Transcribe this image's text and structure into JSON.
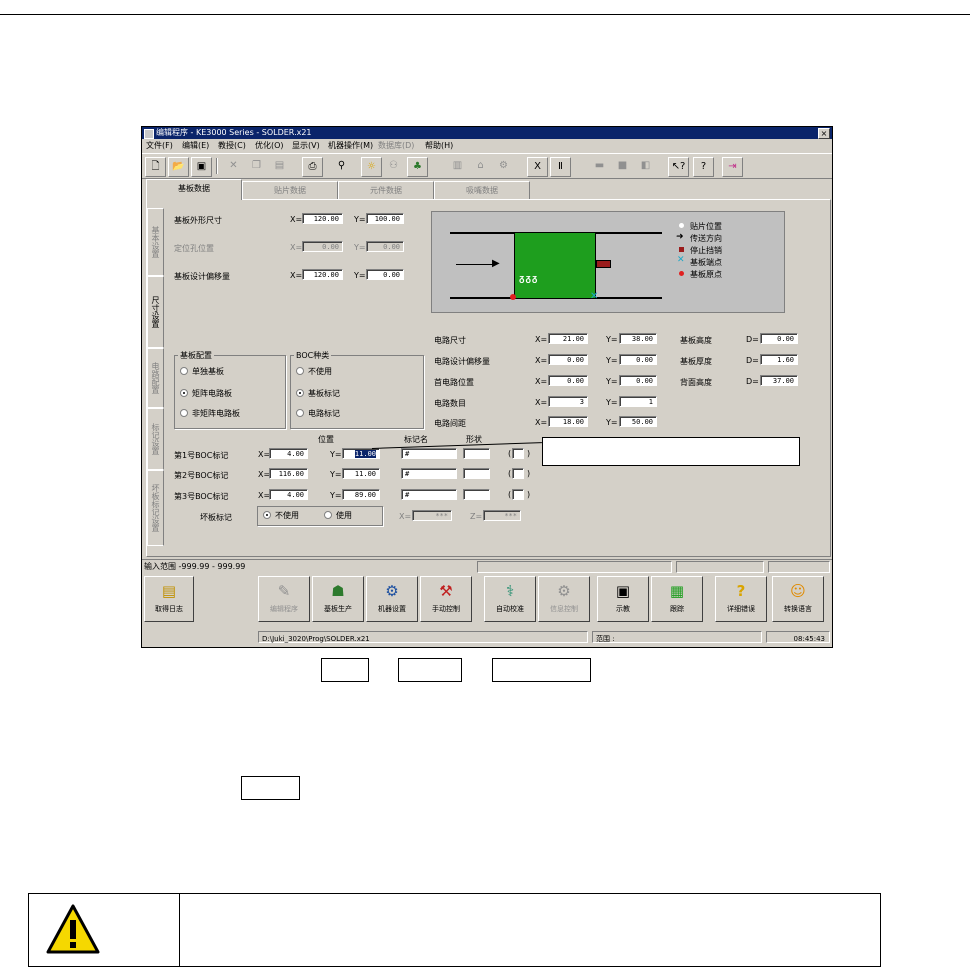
{
  "window": {
    "title": "编辑程序 - KE3000 Series - SOLDER.x21",
    "close_glyph": "×"
  },
  "menu": [
    {
      "label": "文件(F)",
      "enabled": true
    },
    {
      "label": "编辑(E)",
      "enabled": true
    },
    {
      "label": "教授(C)",
      "enabled": true
    },
    {
      "label": "优化(O)",
      "enabled": true
    },
    {
      "label": "显示(V)",
      "enabled": true
    },
    {
      "label": "机器操作(M)",
      "enabled": true
    },
    {
      "label": "数据库(D)",
      "enabled": false
    },
    {
      "label": "帮助(H)",
      "enabled": true
    }
  ],
  "toolbar_icons": [
    "new-icon",
    "open-icon",
    "save-icon",
    "cut-icon",
    "copy-icon",
    "paste-icon",
    "print-icon",
    "find-icon",
    "teach-icon",
    "nozzle-icon",
    "optimize-icon",
    "component-icon",
    "feeder-icon",
    "tray-icon",
    "x-icon",
    "h-icon",
    "stop-icon",
    "square-icon",
    "layer-icon",
    "help-pointer-icon",
    "help-icon",
    "exit-icon"
  ],
  "tabs": [
    "基板数据",
    "贴片数据",
    "元件数据",
    "吸嘴数据"
  ],
  "side_tabs": [
    "基本设置",
    "尺寸设置",
    "电路配置",
    "标记设置",
    "坏板标记设置"
  ],
  "board": {
    "outer_size": {
      "label": "基板外形尺寸",
      "x": "120.00",
      "y": "100.00"
    },
    "hole_pos": {
      "label": "定位孔位置",
      "x": "0.00",
      "y": "0.00"
    },
    "design_offset": {
      "label": "基板设计偏移量",
      "x": "120.00",
      "y": "0.00"
    },
    "x_prefix": "X=",
    "y_prefix": "Y="
  },
  "legend": [
    {
      "label": "贴片位置",
      "icon": "dot-white"
    },
    {
      "label": "传送方向",
      "icon": "arrow"
    },
    {
      "label": "停止挡销",
      "icon": "stopper"
    },
    {
      "label": "基板端点",
      "icon": "x-mark"
    },
    {
      "label": "基板原点",
      "icon": "dot-red"
    }
  ],
  "circuit": {
    "size": {
      "label": "电路尺寸",
      "x": "21.00",
      "y": "38.00"
    },
    "design_offset": {
      "label": "电路设计偏移量",
      "x": "0.00",
      "y": "0.00"
    },
    "first_pos": {
      "label": "首电路位置",
      "x": "0.00",
      "y": "0.00"
    },
    "count": {
      "label": "电路数目",
      "x": "3",
      "y": "1"
    },
    "pitch": {
      "label": "电路间距",
      "x": "18.00",
      "y": "50.00"
    }
  },
  "heights": {
    "board_height": {
      "label": "基板高度",
      "value": "0.00"
    },
    "board_thickness": {
      "label": "基板厚度",
      "value": "1.60"
    },
    "back_height": {
      "label": "背面高度",
      "value": "37.00"
    },
    "prefix": "D="
  },
  "layout_group": {
    "title": "基板配置",
    "options": [
      "单独基板",
      "矩阵电路板",
      "非矩阵电路板"
    ],
    "selected": 1
  },
  "boc_group": {
    "title": "BOC种类",
    "options": [
      "不使用",
      "基板标记",
      "电路标记"
    ],
    "selected": 1
  },
  "boc_headers": {
    "position": "位置",
    "mark_name": "标记名",
    "shape": "形状"
  },
  "boc_marks": [
    {
      "label": "第1号BOC标记",
      "x": "4.00",
      "y": "11.00",
      "name": "#"
    },
    {
      "label": "第2号BOC标记",
      "x": "116.00",
      "y": "11.00",
      "name": "#"
    },
    {
      "label": "第3号BOC标记",
      "x": "4.00",
      "y": "89.00",
      "name": "#"
    }
  ],
  "bad_mark": {
    "label": "坏板标记",
    "options": [
      "不使用",
      "使用"
    ],
    "selected": 0,
    "x": "***",
    "z": "***",
    "x_prefix": "X=",
    "z_prefix": "Z="
  },
  "status": {
    "input_range": "输入范围 -999.99 - 999.99"
  },
  "big_buttons": [
    {
      "label": "取得日志",
      "icon": "log-icon",
      "enabled": true
    },
    {
      "label": "编辑程序",
      "icon": "edit-program-icon",
      "enabled": false
    },
    {
      "label": "基板生产",
      "icon": "production-icon",
      "enabled": true
    },
    {
      "label": "机器设置",
      "icon": "machine-setup-icon",
      "enabled": true
    },
    {
      "label": "手动控制",
      "icon": "manual-control-icon",
      "enabled": true
    },
    {
      "label": "自动校准",
      "icon": "auto-calibration-icon",
      "enabled": true
    },
    {
      "label": "信息控制",
      "icon": "info-control-icon",
      "enabled": false
    },
    {
      "label": "示教",
      "icon": "teach-icon",
      "enabled": true
    },
    {
      "label": "跟踪",
      "icon": "trace-icon",
      "enabled": true
    },
    {
      "label": "详细错误",
      "icon": "help-icon",
      "enabled": true
    },
    {
      "label": "转换语言",
      "icon": "language-icon",
      "enabled": true
    }
  ],
  "pathbar": {
    "path": "D:\\Juki_3020\\Prog\\SOLDER.x21",
    "range_label": "范围 :",
    "time": "08:45:43"
  }
}
